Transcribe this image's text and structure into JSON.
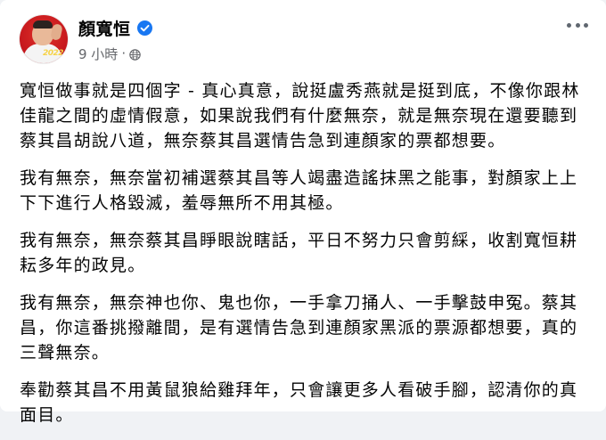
{
  "post": {
    "author_name": "顏寬恒",
    "verified": true,
    "timestamp": "9 小時",
    "separator": "·",
    "privacy_icon": "globe-icon",
    "avatar_text": "2022",
    "more_icon": "more-horizontal-icon",
    "paragraphs": [
      "寬恒做事就是四個字 - 真心真意，說挺盧秀燕就是挺到底，不像你跟林佳龍之間的虛情假意，如果說我們有什麼無奈，就是無奈現在還要聽到蔡其昌胡說八道，無奈蔡其昌選情告急到連顏家的票都想要。",
      "我有無奈，無奈當初補選蔡其昌等人竭盡造謠抹黑之能事，對顏家上上下下進行人格毀滅，羞辱無所不用其極。",
      "我有無奈，無奈蔡其昌睜眼說瞎話，平日不努力只會剪綵，收割寬恒耕耘多年的政見。",
      "我有無奈，無奈神也你、鬼也你，一手拿刀捅人、一手擊鼓申冤。蔡其昌，你這番挑撥離間，是有選情告急到連顏家黑派的票源都想要，真的三聲無奈。",
      "奉勸蔡其昌不用黃鼠狼給雞拜年，只會讓更多人看破手腳，認清你的真面目。"
    ]
  },
  "colors": {
    "verified_blue": "#1877f2",
    "meta_gray": "#65676b",
    "text": "#050505",
    "background": "#ffffff"
  }
}
